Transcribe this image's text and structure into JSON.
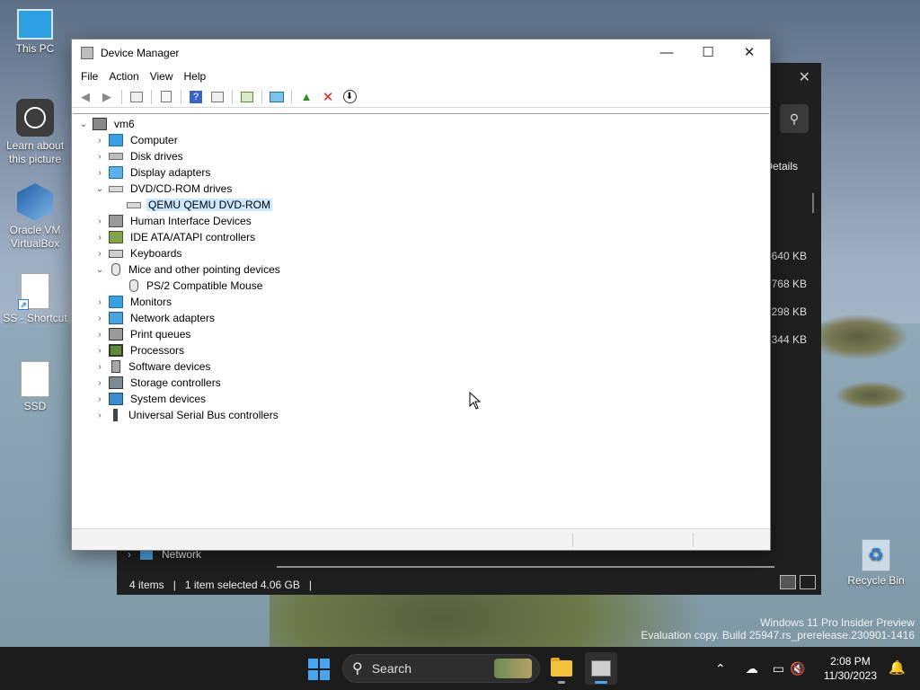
{
  "desktop": {
    "icons": [
      {
        "label": "This PC",
        "icon": "monitor-icon"
      },
      {
        "label": "Learn about this picture",
        "icon": "camera-icon"
      },
      {
        "label": "Oracle VM VirtualBox",
        "icon": "virtualbox-icon"
      },
      {
        "label": "SS - Shortcut",
        "icon": "document-shortcut-icon"
      },
      {
        "label": "SSD",
        "icon": "document-icon"
      },
      {
        "label": "Recycle Bin",
        "icon": "recycle-bin-icon"
      }
    ]
  },
  "background_explorer": {
    "details_label": "Details",
    "sizes": [
      "640 KB",
      "768 KB",
      "298 KB",
      "344 KB"
    ],
    "nav_network": "Network",
    "status": {
      "items": "4 items",
      "selected": "1 item selected  4.06 GB"
    }
  },
  "device_manager": {
    "title": "Device Manager",
    "menu": [
      "File",
      "Action",
      "View",
      "Help"
    ],
    "toolbar": [
      "back-icon",
      "forward-icon",
      "show-hide-console-tree-icon",
      "properties-icon",
      "help-icon",
      "action-pane-icon",
      "update-driver-icon",
      "scan-hardware-icon",
      "enable-device-icon",
      "uninstall-device-icon",
      "disable-device-icon"
    ],
    "root": "vm6",
    "tree": [
      {
        "label": "Computer",
        "expanded": false,
        "icon": "computer-icon"
      },
      {
        "label": "Disk drives",
        "expanded": false,
        "icon": "disk-drive-icon"
      },
      {
        "label": "Display adapters",
        "expanded": false,
        "icon": "display-adapter-icon"
      },
      {
        "label": "DVD/CD-ROM drives",
        "expanded": true,
        "icon": "dvd-drive-icon",
        "children": [
          "QEMU QEMU DVD-ROM"
        ]
      },
      {
        "label": "Human Interface Devices",
        "expanded": false,
        "icon": "hid-icon"
      },
      {
        "label": "IDE ATA/ATAPI controllers",
        "expanded": false,
        "icon": "ide-controller-icon"
      },
      {
        "label": "Keyboards",
        "expanded": false,
        "icon": "keyboard-icon"
      },
      {
        "label": "Mice and other pointing devices",
        "expanded": true,
        "icon": "mouse-icon",
        "children": [
          "PS/2 Compatible Mouse"
        ]
      },
      {
        "label": "Monitors",
        "expanded": false,
        "icon": "monitor-icon"
      },
      {
        "label": "Network adapters",
        "expanded": false,
        "icon": "network-adapter-icon"
      },
      {
        "label": "Print queues",
        "expanded": false,
        "icon": "printer-icon"
      },
      {
        "label": "Processors",
        "expanded": false,
        "icon": "processor-icon"
      },
      {
        "label": "Software devices",
        "expanded": false,
        "icon": "software-device-icon"
      },
      {
        "label": "Storage controllers",
        "expanded": false,
        "icon": "storage-controller-icon"
      },
      {
        "label": "System devices",
        "expanded": false,
        "icon": "system-device-icon"
      },
      {
        "label": "Universal Serial Bus controllers",
        "expanded": false,
        "icon": "usb-icon"
      }
    ],
    "selected_item": "QEMU QEMU DVD-ROM"
  },
  "watermark": {
    "line1": "Windows 11 Pro Insider Preview",
    "line2": "Evaluation copy. Build 25947.rs_prerelease.230901-1416"
  },
  "taskbar": {
    "search_placeholder": "Search",
    "time": "2:08 PM",
    "date": "11/30/2023"
  }
}
